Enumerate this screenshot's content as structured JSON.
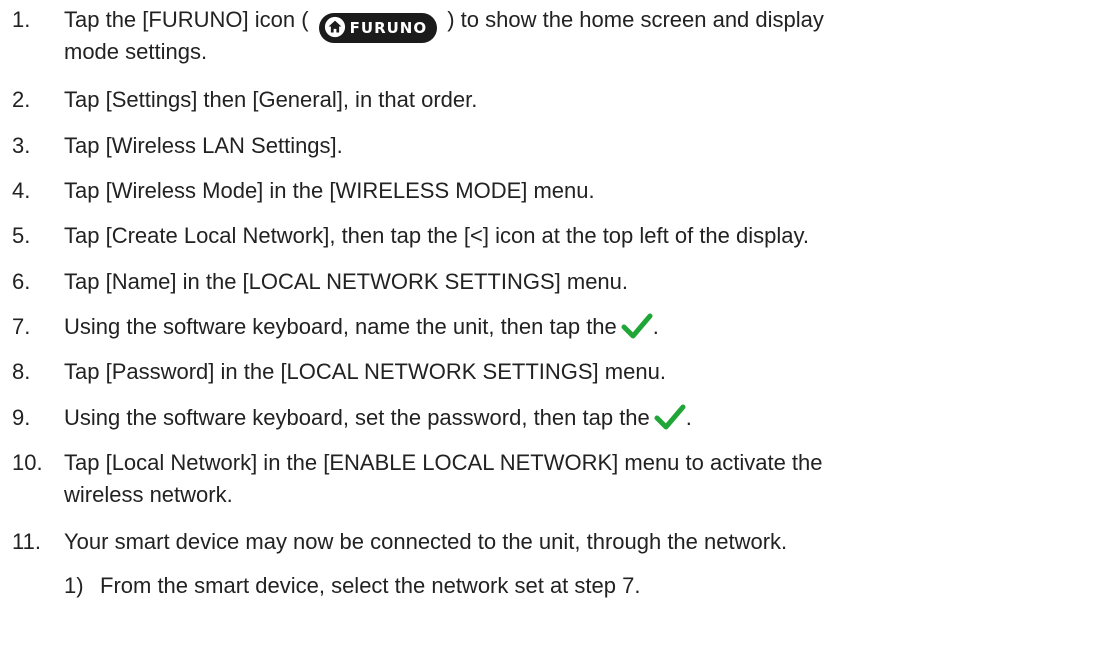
{
  "steps": [
    {
      "num": "1.",
      "before": "Tap the [FURUNO] icon (",
      "badge_text": "FURUNO",
      "after": ") to show the home screen and display",
      "cont": "mode settings."
    },
    {
      "num": "2.",
      "text": "Tap [Settings] then [General], in that order."
    },
    {
      "num": "3.",
      "text": "Tap [Wireless LAN Settings]."
    },
    {
      "num": "4.",
      "text": "Tap [Wireless Mode] in the [WIRELESS MODE] menu."
    },
    {
      "num": "5.",
      "text": "Tap [Create Local Network], then tap the [<] icon at the top left of the display."
    },
    {
      "num": "6.",
      "text": "Tap [Name] in the [LOCAL NETWORK SETTINGS] menu."
    },
    {
      "num": "7.",
      "text": "Using the software keyboard, name the unit, then tap the",
      "end": "."
    },
    {
      "num": "8.",
      "text": "Tap [Password] in the [LOCAL NETWORK SETTINGS] menu."
    },
    {
      "num": "9.",
      "text": "Using the software keyboard, set the password, then tap the",
      "end": "."
    },
    {
      "num": "10.",
      "text": "Tap [Local Network] in the [ENABLE LOCAL NETWORK] menu to activate the",
      "cont": "wireless network."
    },
    {
      "num": "11.",
      "text": "Your smart device may now be connected to the unit, through the network."
    }
  ],
  "substeps": [
    {
      "num": "1)",
      "text": "From the smart device, select the network set at step 7."
    }
  ],
  "icons": {
    "home": "home-icon",
    "check": "checkmark-icon"
  },
  "colors": {
    "badge_bg": "#1b1b1b",
    "check_green": "#1fa637"
  }
}
